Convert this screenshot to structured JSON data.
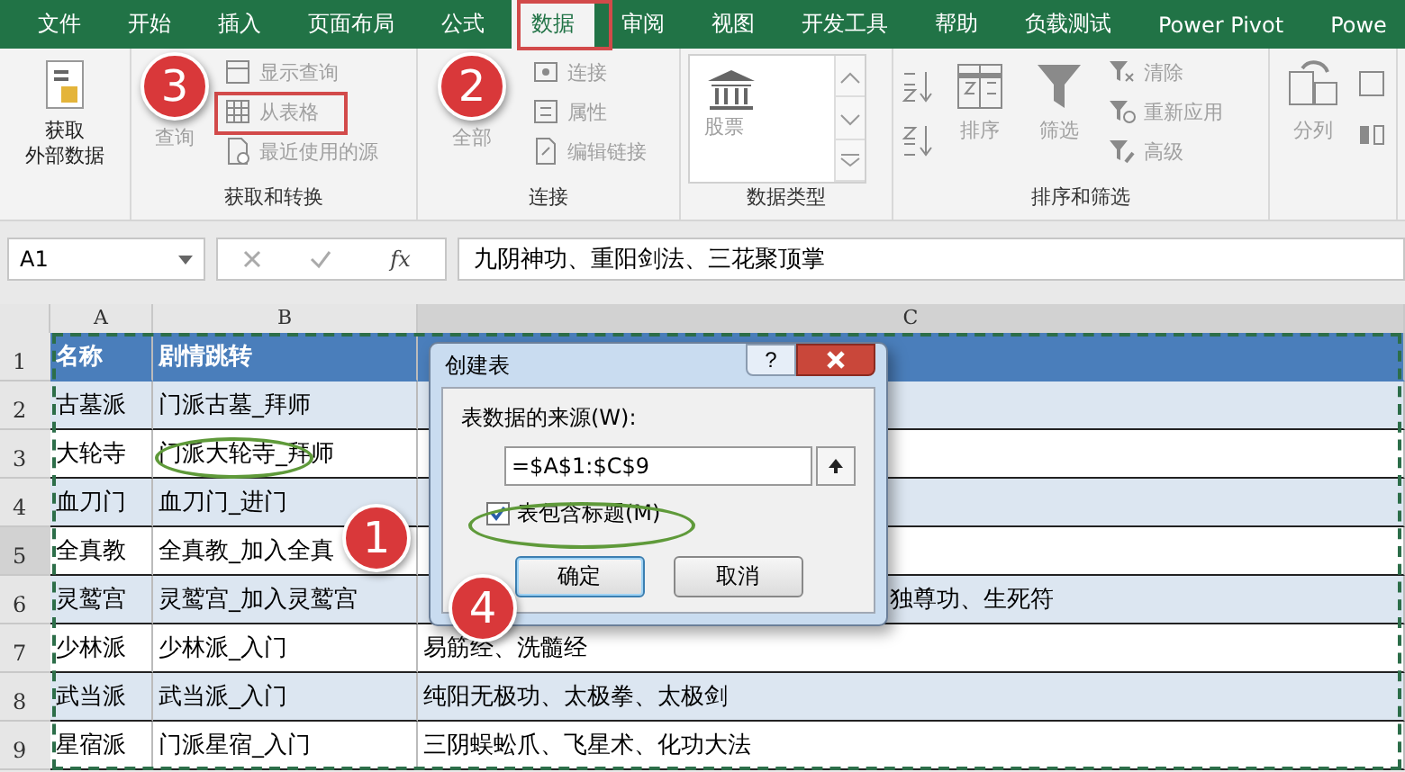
{
  "tabs": [
    {
      "label": "文件",
      "selected": false
    },
    {
      "label": "开始",
      "selected": false
    },
    {
      "label": "插入",
      "selected": false
    },
    {
      "label": "页面布局",
      "selected": false
    },
    {
      "label": "公式",
      "selected": false
    },
    {
      "label": "数据",
      "selected": true
    },
    {
      "label": "审阅",
      "selected": false
    },
    {
      "label": "视图",
      "selected": false
    },
    {
      "label": "开发工具",
      "selected": false
    },
    {
      "label": "帮助",
      "selected": false
    },
    {
      "label": "负载测试",
      "selected": false
    },
    {
      "label": "Power Pivot",
      "selected": false
    },
    {
      "label": "Powe",
      "selected": false
    }
  ],
  "ribbon_groups": [
    {
      "items": [
        {
          "kind": "large",
          "lines": [
            "获取",
            "外部数据"
          ],
          "disabled": false
        }
      ]
    },
    {
      "label": "获取和转换",
      "items": [
        {
          "kind": "large",
          "lines": [
            "查询"
          ],
          "disabled": true
        },
        {
          "kind": "stack",
          "items": [
            {
              "label": "显示查询",
              "disabled": true
            },
            {
              "label": "从表格",
              "disabled": true
            },
            {
              "label": "最近使用的源",
              "disabled": true
            }
          ]
        }
      ]
    },
    {
      "label": "连接",
      "items": [
        {
          "kind": "large",
          "lines": [
            "全部"
          ],
          "disabled": true
        },
        {
          "kind": "stack",
          "items": [
            {
              "label": "连接",
              "disabled": true
            },
            {
              "label": "属性",
              "disabled": true
            },
            {
              "label": "编辑链接",
              "disabled": true
            }
          ]
        }
      ]
    },
    {
      "label": "数据类型",
      "items": [
        {
          "kind": "gallery",
          "lines": [
            "股票"
          ],
          "disabled": true
        }
      ]
    },
    {
      "label": "排序和筛选",
      "items": [
        {
          "kind": "sort_arrows",
          "disabled": true
        },
        {
          "kind": "large",
          "lines": [
            "排序"
          ],
          "disabled": true
        },
        {
          "kind": "large",
          "lines": [
            "筛选"
          ],
          "disabled": true
        },
        {
          "kind": "stack",
          "items": [
            {
              "label": "清除",
              "disabled": true
            },
            {
              "label": "重新应用",
              "disabled": true
            },
            {
              "label": "高级",
              "disabled": true
            }
          ]
        }
      ]
    },
    {
      "items": [
        {
          "kind": "large",
          "lines": [
            "分列"
          ],
          "disabled": true
        },
        {
          "kind": "icon_stack",
          "disabled": true
        }
      ]
    }
  ],
  "formula_bar": {
    "name_box": "A1",
    "function_button": "fx",
    "formula": "九阴神功、重阳剑法、三花聚顶掌"
  },
  "columns": [
    {
      "label": "A",
      "selected": false
    },
    {
      "label": "B",
      "selected": false
    },
    {
      "label": "C",
      "selected": true
    }
  ],
  "rows": [
    {
      "number": "1",
      "selected": false,
      "kind": "header",
      "a": "名称",
      "b": "剧情跳转"
    },
    {
      "number": "2",
      "selected": false,
      "kind": "band",
      "a": "古墓派",
      "b": "门派古墓_拜师"
    },
    {
      "number": "3",
      "selected": false,
      "kind": "plain",
      "a": "大轮寺",
      "b": "门派大轮寺_拜师"
    },
    {
      "number": "4",
      "selected": false,
      "kind": "band",
      "a": "血刀门",
      "b": "血刀门_进门"
    },
    {
      "number": "5",
      "selected": true,
      "kind": "plain",
      "a": "全真教",
      "b": "全真教_加入全真"
    },
    {
      "number": "6",
      "selected": false,
      "kind": "band",
      "a": "灵鹫宫",
      "b": "灵鹫宫_加入灵鹫宫",
      "c": {
        "text": "独尊功、生死符",
        "kind": "behind_dialog"
      }
    },
    {
      "number": "7",
      "selected": false,
      "kind": "plain",
      "a": "少林派",
      "b": "少林派_入门",
      "c": {
        "text": "易筋经、洗髓经",
        "kind": "plain"
      }
    },
    {
      "number": "8",
      "selected": false,
      "kind": "band",
      "a": "武当派",
      "b": "武当派_入门",
      "c": {
        "text": "纯阳无极功、太极拳、太极剑",
        "kind": "plain"
      }
    },
    {
      "number": "9",
      "selected": false,
      "kind": "plain",
      "a": "星宿派",
      "b": "门派星宿_入门",
      "c": {
        "text": "三阴蜈蚣爪、飞星术、化功大法",
        "kind": "plain"
      }
    }
  ],
  "dialog": {
    "title": "创建表",
    "help": "?",
    "source_label": "表数据的来源(W):",
    "source_value": "=$A$1:$C$9",
    "header_checkbox": {
      "label": "表包含标题(M)",
      "checked": true
    },
    "buttons": [
      {
        "label": "确定",
        "selected": true
      },
      {
        "label": "取消",
        "selected": false
      }
    ]
  },
  "markers": [
    {
      "number": "3"
    },
    {
      "number": "2"
    },
    {
      "number": "1"
    },
    {
      "number": "4"
    }
  ]
}
